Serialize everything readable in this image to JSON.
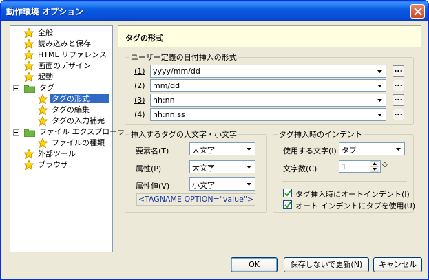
{
  "window": {
    "title": "動作環境 オプション"
  },
  "tree": {
    "items": [
      {
        "label": "全般",
        "icon": "star-icon"
      },
      {
        "label": "読み込みと保存",
        "icon": "star-icon"
      },
      {
        "label": "HTML リファレンス",
        "icon": "star-icon"
      },
      {
        "label": "画面のデザイン",
        "icon": "star-icon"
      },
      {
        "label": "起動",
        "icon": "star-icon"
      },
      {
        "label": "タグ",
        "icon": "folder-icon"
      },
      {
        "label": "タグの形式",
        "icon": "star-icon",
        "selected": true
      },
      {
        "label": "タグの編集",
        "icon": "star-icon"
      },
      {
        "label": "タグの入力補完",
        "icon": "star-icon"
      },
      {
        "label": "ファイル エクスプローラ",
        "icon": "folder-icon"
      },
      {
        "label": "ファイルの種類",
        "icon": "star-icon"
      },
      {
        "label": "外部ツール",
        "icon": "star-icon"
      },
      {
        "label": "ブラウザ",
        "icon": "star-icon"
      }
    ]
  },
  "header": {
    "title": "タグの形式"
  },
  "date_group": {
    "legend": "ユーザー定義の日付挿入の形式",
    "rows": [
      {
        "num": "1",
        "value": "yyyy/mm/dd"
      },
      {
        "num": "2",
        "value": "mm/dd"
      },
      {
        "num": "3",
        "value": "hh:nn"
      },
      {
        "num": "4",
        "value": "hh:nn:ss"
      }
    ],
    "dots_label": "..."
  },
  "case_group": {
    "legend": "挿入するタグの大文字・小文字",
    "rows": [
      {
        "label": "要素名(T)",
        "value": "大文字"
      },
      {
        "label": "属性(P)",
        "value": "大文字"
      },
      {
        "label": "属性値(V)",
        "value": "小文字"
      }
    ],
    "preview": "<TAGNAME OPTION=\"value\">"
  },
  "indent_group": {
    "legend": "タグ挿入時のインデント",
    "char_label": "使用する文字(I)",
    "char_value": "タブ",
    "count_label": "文字数(C)",
    "count_value": "1",
    "auto_indent_label": "タグ挿入時にオートインデント(I)",
    "use_tab_label": "オート インデントにタブを使用(U)",
    "auto_indent_checked": true,
    "use_tab_checked": true
  },
  "buttons": {
    "ok": "OK",
    "apply": "保存しないで更新(N)",
    "cancel": "キャンセル"
  }
}
